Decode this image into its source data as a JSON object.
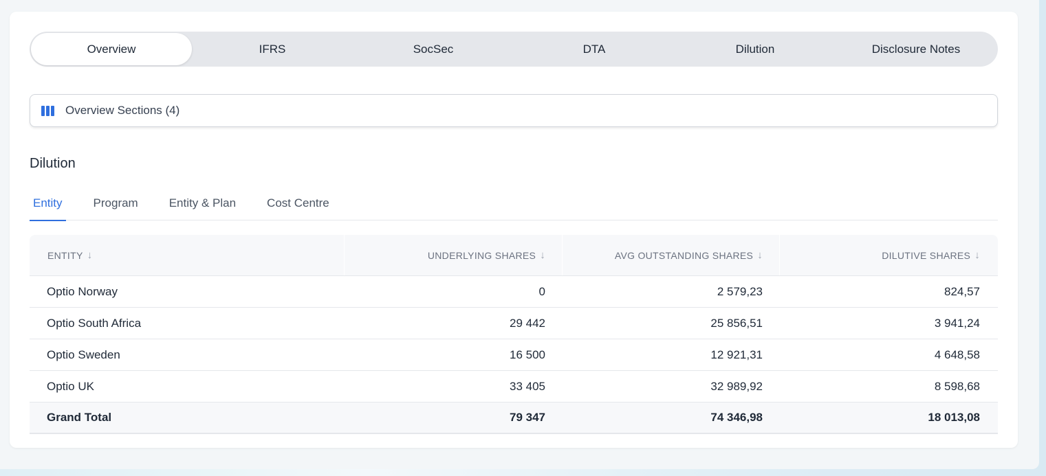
{
  "top_tabs": [
    {
      "label": "Overview",
      "active": true
    },
    {
      "label": "IFRS",
      "active": false
    },
    {
      "label": "SocSec",
      "active": false
    },
    {
      "label": "DTA",
      "active": false
    },
    {
      "label": "Dilution",
      "active": false
    },
    {
      "label": "Disclosure Notes",
      "active": false
    }
  ],
  "sections_bar": {
    "label": "Overview Sections (4)",
    "icon": "columns-icon"
  },
  "section_title": "Dilution",
  "sub_tabs": [
    {
      "label": "Entity",
      "active": true
    },
    {
      "label": "Program",
      "active": false
    },
    {
      "label": "Entity & Plan",
      "active": false
    },
    {
      "label": "Cost Centre",
      "active": false
    }
  ],
  "table": {
    "columns": [
      "ENTITY",
      "UNDERLYING SHARES",
      "AVG OUTSTANDING SHARES",
      "DILUTIVE SHARES"
    ],
    "rows": [
      [
        "Optio Norway",
        "0",
        "2 579,23",
        "824,57"
      ],
      [
        "Optio South Africa",
        "29 442",
        "25 856,51",
        "3 941,24"
      ],
      [
        "Optio Sweden",
        "16 500",
        "12 921,31",
        "4 648,58"
      ],
      [
        "Optio UK",
        "33 405",
        "32 989,92",
        "8 598,68"
      ]
    ],
    "total": [
      "Grand Total",
      "79 347",
      "74 346,98",
      "18 013,08"
    ]
  },
  "colors": {
    "accent": "#2f6fde"
  }
}
